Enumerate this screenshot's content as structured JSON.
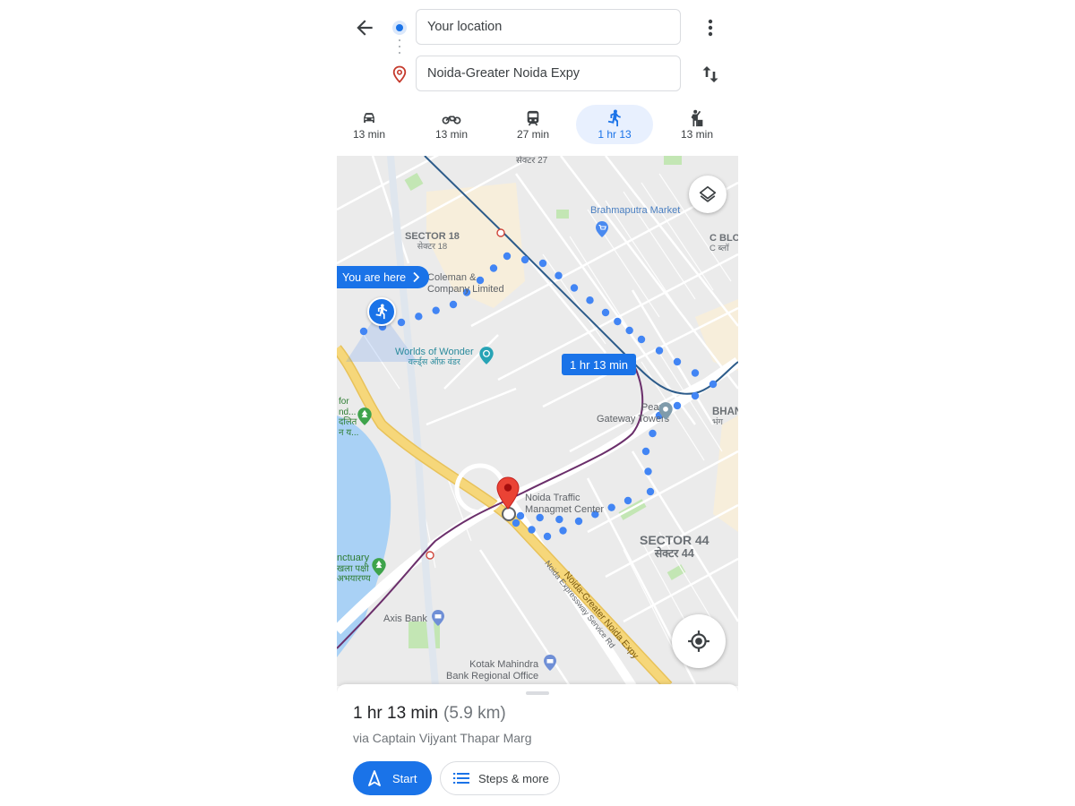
{
  "header": {
    "origin_value": "Your location",
    "destination_value": "Noida-Greater Noida Expy",
    "icons": {
      "back": "arrow-back-icon",
      "origin": "origin-dot-icon",
      "destination": "destination-pin-icon",
      "more": "more-vert-icon",
      "swap": "swap-vertical-icon"
    }
  },
  "modes": [
    {
      "name": "drive",
      "icon": "car-icon",
      "label": "13 min",
      "active": false
    },
    {
      "name": "two-wheeler",
      "icon": "motorbike-icon",
      "label": "13 min",
      "active": false
    },
    {
      "name": "transit",
      "icon": "train-icon",
      "label": "27 min",
      "active": false
    },
    {
      "name": "walk",
      "icon": "walking-icon",
      "label": "1 hr 13",
      "active": true
    },
    {
      "name": "ride",
      "icon": "ride-hailing-icon",
      "label": "13 min",
      "active": false
    }
  ],
  "map": {
    "labels": {
      "sector27_hi": "सेक्टर 27",
      "sector18_en": "SECTOR 18",
      "sector18_hi": "सेक्टर 18",
      "brahmaputra": "Brahmaputra Market",
      "cblock_en": "C BLO",
      "cblock_hi": "C ब्लॉ",
      "coleman_1": "Coleman &",
      "coleman_2": "Company Limited",
      "wow_en": "Worlds of Wonder",
      "wow_hi": "वर्ल्ड्स ऑफ़ वंडर",
      "pearls_1": "Pearls",
      "pearls_2": "Gateway Towers",
      "bhan_en": "BHAN",
      "bhan_hi": "भंग",
      "park_1": "for",
      "park_2": "nd...",
      "park_3": "दलित",
      "park_4": "न य...",
      "traffic_1": "Noida Traffic",
      "traffic_2": "Managmet Center",
      "sector44_en": "SECTOR 44",
      "sector44_hi": "सेक्टर 44",
      "sanct_1": "nctuary",
      "sanct_2": "खला पक्षी",
      "sanct_3": "अभयारण्य",
      "service_rd": "Noida Expressway Service Rd",
      "expy": "Noida-Greater Noida Expy",
      "axis": "Axis Bank",
      "kotak_1": "Kotak Mahindra",
      "kotak_2": "Bank Regional Office"
    },
    "you_are_here": "You are here",
    "route_time": "1 hr 13 min",
    "colors": {
      "route": "#4285f4",
      "metro_blue": "#2c5b8a",
      "metro_purple": "#6b2f6b",
      "expressway": "#f6d77a",
      "water": "#a9d1f5",
      "park": "#c3e6b4",
      "commercial": "#f7eedb"
    }
  },
  "sheet": {
    "duration": "1 hr 13 min",
    "distance": "(5.9 km)",
    "via": "via Captain Vijyant Thapar Marg",
    "start_label": "Start",
    "steps_label": "Steps & more"
  }
}
